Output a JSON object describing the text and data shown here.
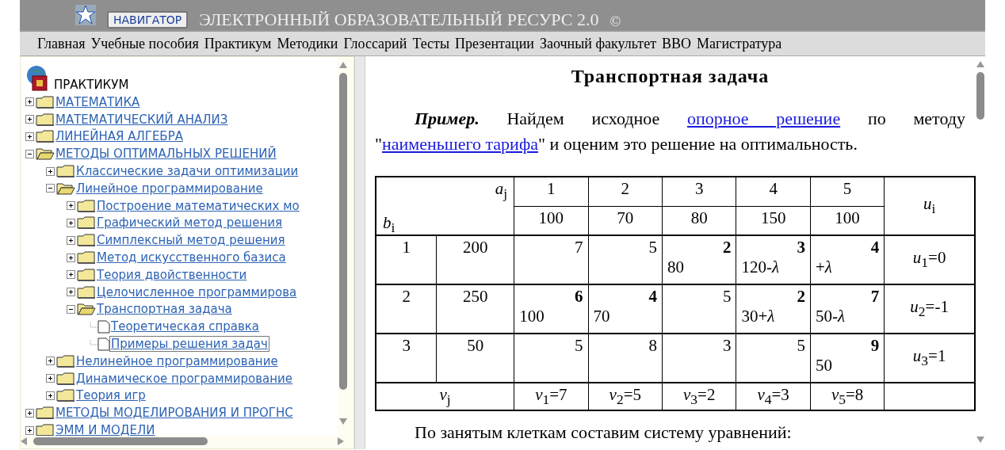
{
  "header": {
    "navigator_button": "НАВИГАТОР",
    "title": "ЭЛЕКТРОННЫЙ ОБРАЗОВАТЕЛЬНЫЙ РЕСУРС 2.0",
    "copyright": "©"
  },
  "menu": [
    "Главная",
    "Учебные пособия",
    "Практикум",
    "Методики",
    "Глоссарий",
    "Тесты",
    "Презентации",
    "Заочный факультет",
    "ВВО",
    "Магистратура"
  ],
  "sidebar": {
    "root": "ПРАКТИКУМ",
    "tree": [
      {
        "label": "МАТЕМАТИКА",
        "kind": "folder",
        "expanded": false,
        "selected": false
      },
      {
        "label": "МАТЕМАТИЧЕСКИЙ АНАЛИЗ",
        "kind": "folder",
        "expanded": false,
        "selected": false
      },
      {
        "label": "ЛИНЕЙНАЯ АЛГЕБРА",
        "kind": "folder",
        "expanded": false,
        "selected": false
      },
      {
        "label": "МЕТОДЫ ОПТИМАЛЬНЫХ РЕШЕНИЙ",
        "kind": "folder",
        "expanded": true,
        "selected": false,
        "children": [
          {
            "label": "Классические задачи оптимизации",
            "kind": "folder",
            "expanded": false,
            "selected": false
          },
          {
            "label": "Линейное программирование",
            "kind": "folder",
            "expanded": true,
            "selected": false,
            "children": [
              {
                "label": "Построение математических мо",
                "kind": "folder",
                "expanded": false,
                "selected": false
              },
              {
                "label": "Графический метод решения",
                "kind": "folder",
                "expanded": false,
                "selected": false
              },
              {
                "label": "Симплексный метод решения",
                "kind": "folder",
                "expanded": false,
                "selected": false
              },
              {
                "label": "Метод искусственного базиса",
                "kind": "folder",
                "expanded": false,
                "selected": false
              },
              {
                "label": "Теория двойственности",
                "kind": "folder",
                "expanded": false,
                "selected": false
              },
              {
                "label": "Целочисленное программирова",
                "kind": "folder",
                "expanded": false,
                "selected": false
              },
              {
                "label": "Транспортная задача",
                "kind": "folder",
                "expanded": true,
                "selected": false,
                "children": [
                  {
                    "label": "Теоретическая справка",
                    "kind": "page",
                    "selected": false
                  },
                  {
                    "label": "Примеры решения задач",
                    "kind": "page",
                    "selected": true
                  }
                ]
              }
            ]
          },
          {
            "label": "Нелинейное программирование",
            "kind": "folder",
            "expanded": false,
            "selected": false
          },
          {
            "label": "Динамическое программирование",
            "kind": "folder",
            "expanded": false,
            "selected": false
          },
          {
            "label": "Теория игр",
            "kind": "folder",
            "expanded": false,
            "selected": false
          }
        ]
      },
      {
        "label": "МЕТОДЫ МОДЕЛИРОВАНИЯ И ПРОГНС",
        "kind": "folder",
        "expanded": false,
        "selected": false
      },
      {
        "label": "ЭММ И МОДЕЛИ",
        "kind": "folder",
        "expanded": false,
        "selected": false
      }
    ]
  },
  "content": {
    "title": "Транспортная задача",
    "intro": [
      {
        "kind": "bold",
        "text": "Пример."
      },
      {
        "kind": "text",
        "text": " Найдем исходное "
      },
      {
        "kind": "link",
        "text": "опорное решение"
      },
      {
        "kind": "text",
        "text": " по методу \""
      },
      {
        "kind": "link",
        "text": "наименьшего тарифа"
      },
      {
        "kind": "text",
        "text": "\" и оценим это решение на оптимальность."
      }
    ],
    "table": {
      "corner_top": "*a*$_{j}$",
      "corner_bottom": "*b*$_{i}$",
      "columns": [
        "1",
        "2",
        "3",
        "4",
        "5"
      ],
      "demand": [
        "100",
        "70",
        "80",
        "150",
        "100"
      ],
      "potential_header": "*u*$_{i}$",
      "rows": [
        {
          "number": "1",
          "supply": "200",
          "cells": [
            {
              "cost": "7",
              "basic": false
            },
            {
              "cost": "5",
              "basic": false
            },
            {
              "cost": "2",
              "basic": true,
              "amount": "80"
            },
            {
              "cost": "3",
              "basic": true,
              "amount": "120-*λ*"
            },
            {
              "cost": "4",
              "basic": true,
              "amount": "+*λ*"
            }
          ],
          "potential": "*u*$_{1}$=0"
        },
        {
          "number": "2",
          "supply": "250",
          "cells": [
            {
              "cost": "6",
              "basic": true,
              "amount": "100"
            },
            {
              "cost": "4",
              "basic": true,
              "amount": "70"
            },
            {
              "cost": "5",
              "basic": false
            },
            {
              "cost": "2",
              "basic": true,
              "amount": "30+*λ*"
            },
            {
              "cost": "7",
              "basic": true,
              "amount": "50-*λ*"
            }
          ],
          "potential": "*u*$_{2}$=-1"
        },
        {
          "number": "3",
          "supply": "50",
          "cells": [
            {
              "cost": "5",
              "basic": false
            },
            {
              "cost": "8",
              "basic": false
            },
            {
              "cost": "3",
              "basic": false
            },
            {
              "cost": "5",
              "basic": false
            },
            {
              "cost": "9",
              "basic": true,
              "amount": "50"
            }
          ],
          "potential": "*u*$_{3}$=1"
        }
      ],
      "footer_label": "*v*$_{j}$",
      "footer": [
        "*v*$_{1}$=7",
        "*v*$_{2}$=5",
        "*v*$_{3}$=2",
        "*v*$_{4}$=3",
        "*v*$_{5}$=8"
      ]
    },
    "next_paragraph": "По занятым клеткам составим систему уравнений:"
  }
}
